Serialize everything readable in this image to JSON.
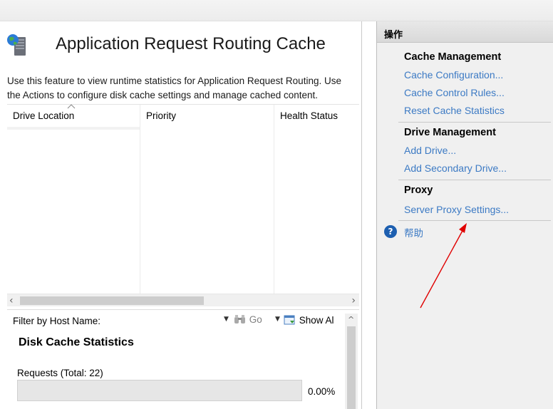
{
  "main": {
    "title": "Application Request Routing Cache",
    "description": "Use this feature to view runtime statistics for Application Request Routing.  Use the Actions to configure disk cache settings and manage cached content.",
    "columns": [
      "Drive Location",
      "Priority",
      "Health Status"
    ],
    "filter": {
      "label": "Filter by Host Name:",
      "value": "",
      "go_label": "Go",
      "show_all_label": "Show Al"
    },
    "stats": {
      "title": "Disk Cache Statistics",
      "requests_label": "Requests (Total: 22)",
      "requests_percent": "0.00%",
      "requests_fraction": 0.0
    }
  },
  "actions": {
    "header": "操作",
    "sections": [
      {
        "title": "Cache Management",
        "links": [
          "Cache Configuration...",
          "Cache Control Rules...",
          "Reset Cache Statistics"
        ]
      },
      {
        "title": "Drive Management",
        "links": [
          "Add Drive...",
          "Add Secondary Drive..."
        ]
      },
      {
        "title": "Proxy",
        "links": [
          "Server Proxy Settings..."
        ]
      }
    ],
    "help_label": "帮助"
  },
  "colors": {
    "link": "#3c7ac4",
    "annotation_arrow": "#e00000",
    "help_icon": "#1d5fb0"
  },
  "icons": {
    "title": "server-globe-icon",
    "go": "binoculars-icon",
    "show_all": "show-all-icon",
    "help": "help-icon"
  }
}
